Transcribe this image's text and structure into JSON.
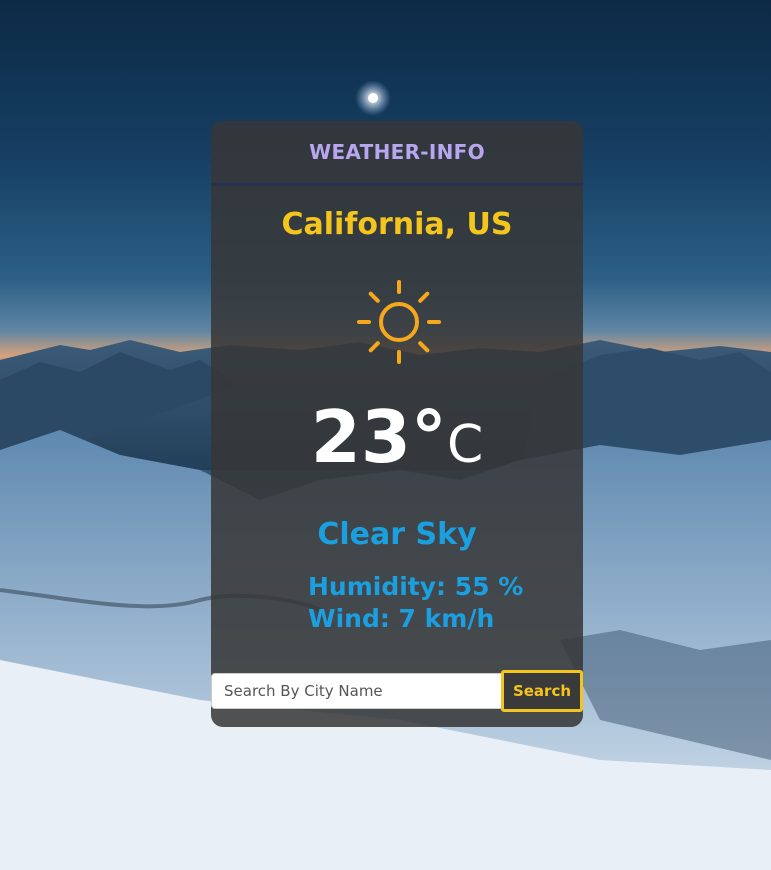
{
  "app": {
    "title": "WEATHER-INFO"
  },
  "weather": {
    "location": "California, US",
    "icon": "sun-icon",
    "temperature": "23°",
    "unit": "C",
    "condition": "Clear Sky",
    "humidity": "Humidity: 55 %",
    "wind": "Wind: 7 km/h"
  },
  "search": {
    "placeholder": "Search By City Name",
    "value": "",
    "button_label": "Search"
  },
  "colors": {
    "accent_yellow": "#f4c51c",
    "title_purple": "#b8a6f0",
    "info_blue": "#1aa0e0",
    "card_bg": "#373737"
  }
}
